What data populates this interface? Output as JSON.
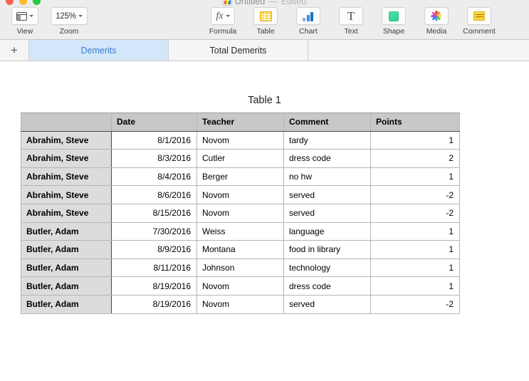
{
  "window": {
    "title": "Untitled",
    "separator": "—",
    "edited_label": "Edited",
    "app_icon": "numbers-document-icon"
  },
  "toolbar": {
    "left_items": [
      {
        "label": "View",
        "icon": "view-panel-icon",
        "has_chevron": true
      },
      {
        "label": "Zoom",
        "value": "125%",
        "icon": "zoom-value",
        "has_chevron": true
      }
    ],
    "right_items": [
      {
        "label": "Formula",
        "icon": "fx-icon",
        "glyph": "fx",
        "has_chevron": true
      },
      {
        "label": "Table",
        "icon": "table-grid-icon",
        "has_chevron": false
      },
      {
        "label": "Chart",
        "icon": "bar-chart-icon",
        "has_chevron": false
      },
      {
        "label": "Text",
        "icon": "text-t-icon",
        "glyph": "T",
        "has_chevron": false
      },
      {
        "label": "Shape",
        "icon": "shape-square-icon",
        "has_chevron": false
      },
      {
        "label": "Media",
        "icon": "media-photos-icon",
        "has_chevron": false
      },
      {
        "label": "Comment",
        "icon": "comment-note-icon",
        "has_chevron": false
      }
    ]
  },
  "tabs": {
    "add_label": "+",
    "sheets": [
      {
        "label": "Demerits",
        "active": true
      },
      {
        "label": "Total Demerits",
        "active": false
      }
    ]
  },
  "sheet": {
    "table_title": "Table 1",
    "headers": [
      "",
      "Date",
      "Teacher",
      "Comment",
      "Points"
    ],
    "rows": [
      {
        "name": "Abrahim, Steve",
        "date": "8/1/2016",
        "teacher": "Novom",
        "comment": "tardy",
        "points": "1"
      },
      {
        "name": "Abrahim, Steve",
        "date": "8/3/2016",
        "teacher": "Cutler",
        "comment": "dress code",
        "points": "2"
      },
      {
        "name": "Abrahim, Steve",
        "date": "8/4/2016",
        "teacher": "Berger",
        "comment": "no hw",
        "points": "1"
      },
      {
        "name": "Abrahim, Steve",
        "date": "8/6/2016",
        "teacher": "Novom",
        "comment": "served",
        "points": "-2"
      },
      {
        "name": "Abrahim, Steve",
        "date": "8/15/2016",
        "teacher": "Novom",
        "comment": "served",
        "points": "-2"
      },
      {
        "name": "Butler, Adam",
        "date": "7/30/2016",
        "teacher": "Weiss",
        "comment": "language",
        "points": "1"
      },
      {
        "name": "Butler, Adam",
        "date": "8/9/2016",
        "teacher": "Montana",
        "comment": "food in library",
        "points": "1"
      },
      {
        "name": "Butler, Adam",
        "date": "8/11/2016",
        "teacher": "Johnson",
        "comment": "technology",
        "points": "1"
      },
      {
        "name": "Butler, Adam",
        "date": "8/19/2016",
        "teacher": "Novom",
        "comment": "dress code",
        "points": "1"
      },
      {
        "name": "Butler, Adam",
        "date": "8/19/2016",
        "teacher": "Novom",
        "comment": "served",
        "points": "-2"
      }
    ]
  },
  "colors": {
    "tab_active_bg": "#d4e6fa",
    "tab_active_text": "#3b7fd4",
    "toolbar_bg": "#ededed",
    "header_bg": "#c8c8c8",
    "rowheader_bg": "#dcdcdc"
  }
}
